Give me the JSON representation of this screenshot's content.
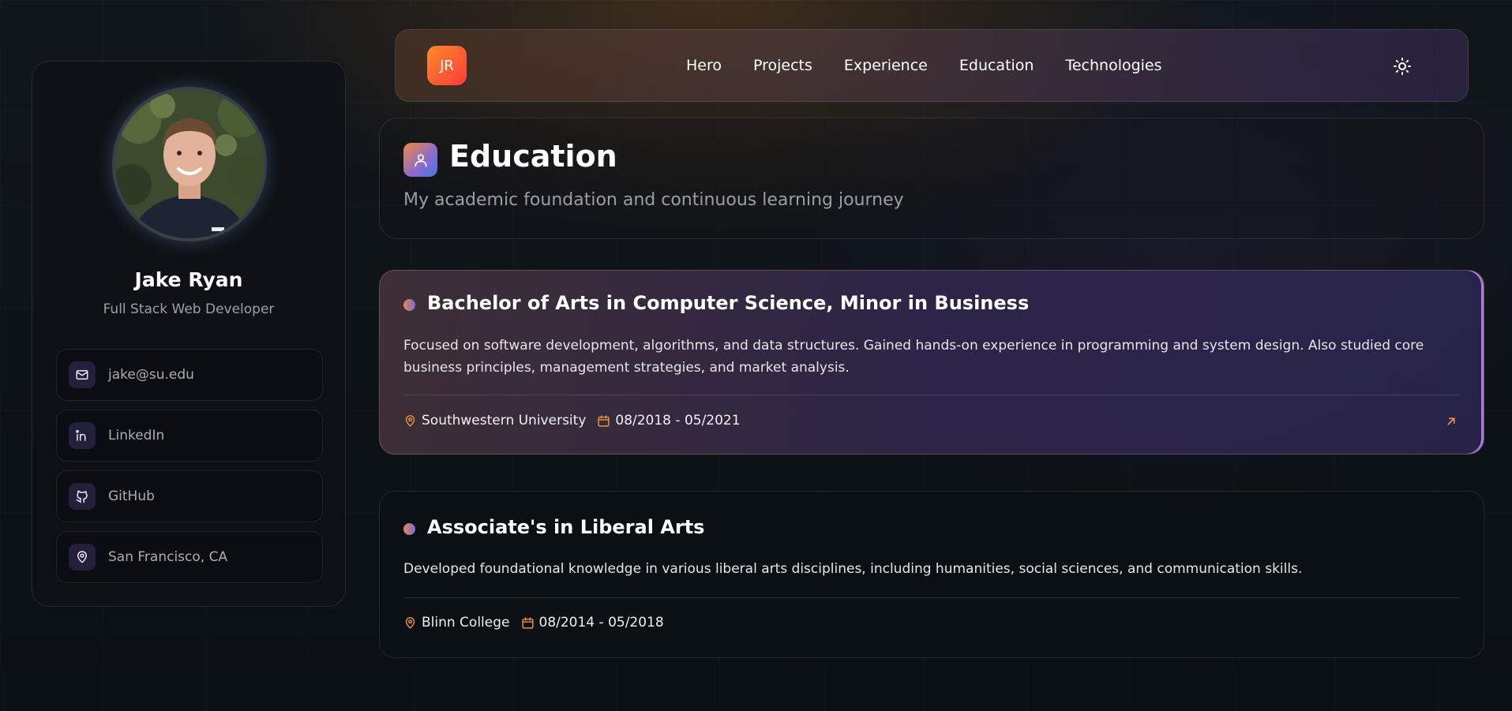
{
  "profile": {
    "name": "Jake Ryan",
    "role": "Full Stack Web Developer",
    "contacts": [
      {
        "label": "jake@su.edu",
        "icon": "mail-icon"
      },
      {
        "label": "LinkedIn",
        "icon": "linkedin-icon"
      },
      {
        "label": "GitHub",
        "icon": "github-icon"
      },
      {
        "label": "San Francisco, CA",
        "icon": "map-pin-icon"
      }
    ]
  },
  "nav": {
    "logo": "JR",
    "links": [
      "Hero",
      "Projects",
      "Experience",
      "Education",
      "Technologies"
    ],
    "theme_icon": "sun-icon"
  },
  "section": {
    "title": "Education",
    "subtitle": "My academic foundation and continuous learning journey",
    "icon": "user-icon"
  },
  "education": [
    {
      "title": "Bachelor of Arts in Computer Science, Minor in Business",
      "description": "Focused on software development, algorithms, and data structures. Gained hands-on experience in programming and system design. Also studied core business principles, management strategies, and market analysis.",
      "institution": "Southwestern University",
      "dates": "08/2018 - 05/2021"
    },
    {
      "title": "Associate's in Liberal Arts",
      "description": "Developed foundational knowledge in various liberal arts disciplines, including humanities, social sciences, and communication skills.",
      "institution": "Blinn College",
      "dates": "08/2014 - 05/2018"
    }
  ],
  "colors": {
    "accent": "#f08a3c",
    "accent_secondary": "#7a6ae0",
    "background": "#0c1116"
  }
}
